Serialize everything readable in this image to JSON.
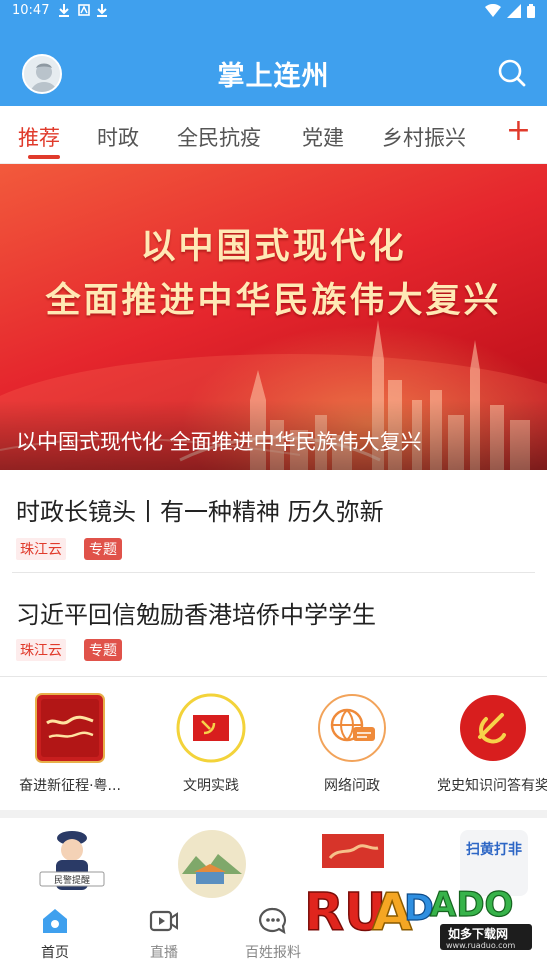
{
  "status_bar": {
    "time": "10:47"
  },
  "header": {
    "title": "掌上连州"
  },
  "tabs": [
    {
      "label": "推荐",
      "active": true
    },
    {
      "label": "时政",
      "active": false
    },
    {
      "label": "全民抗疫",
      "active": false
    },
    {
      "label": "党建",
      "active": false
    },
    {
      "label": "乡村振兴",
      "active": false
    }
  ],
  "banner": {
    "headline_line1": "以中国式现代化",
    "headline_line2": "全面推进中华民族伟大复兴",
    "caption": "以中国式现代化 全面推进中华民族伟大复兴"
  },
  "news": [
    {
      "title": "时政长镜头丨有一种精神 历久弥新",
      "source": "珠江云",
      "tag": "专题"
    },
    {
      "title": "习近平回信勉励香港培侨中学学生",
      "source": "珠江云",
      "tag": "专题"
    }
  ],
  "features": [
    {
      "label": "奋进新征程·粤...",
      "icon": "calligraphy-poster-icon"
    },
    {
      "label": "文明实践",
      "icon": "party-flag-icon"
    },
    {
      "label": "网络问政",
      "icon": "globe-chat-icon"
    },
    {
      "label": "党史知识问答有奖",
      "icon": "party-emblem-icon"
    }
  ],
  "row2_icons": [
    "police-icon",
    "village-icon",
    "red-poster-icon",
    "anti-porn-icon"
  ],
  "row2_text": {
    "anti_porn_label": "扫黄打非",
    "police_label": "民警提醒"
  },
  "bottom_nav": [
    {
      "label": "首页",
      "icon": "home-icon",
      "active": true
    },
    {
      "label": "直播",
      "icon": "video-icon",
      "active": false
    },
    {
      "label": "百姓报料",
      "icon": "chat-bubble-icon",
      "active": false
    }
  ],
  "watermark": {
    "brand": "RUANDADO",
    "sub": "如多下载网",
    "url": "www.ruaduo.com"
  },
  "colors": {
    "header_blue": "#3fa0ee",
    "accent_red": "#e03a2b"
  }
}
